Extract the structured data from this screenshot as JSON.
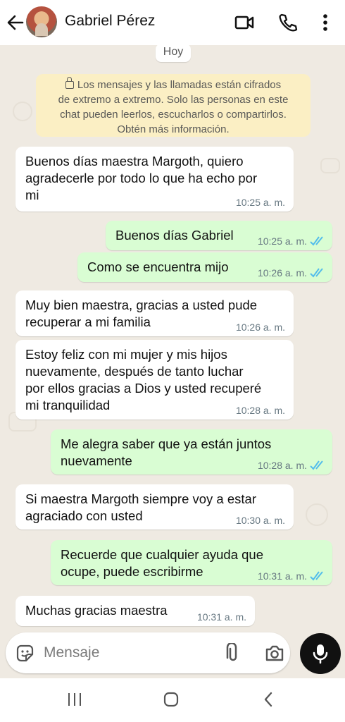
{
  "header": {
    "contact_name": "Gabriel Pérez",
    "icons": [
      "back-arrow-icon",
      "avatar",
      "video-call-icon",
      "phone-icon",
      "more-options-icon"
    ]
  },
  "chat": {
    "date_chip": "Hoy",
    "encryption_notice": "Los mensajes y las llamadas están cifrados\nde extremo a extremo. Solo las personas en este\nchat pueden leerlos, escucharlos o compartirlos.\nObtén más información.",
    "messages": [
      {
        "direction": "incoming",
        "text": "Buenos días maestra Margoth, quiero\nagradecerle por todo lo que ha echo por\nmi",
        "time": "10:25 a. m."
      },
      {
        "direction": "outgoing",
        "text": "Buenos días Gabriel",
        "time": "10:25 a. m.",
        "status": "read"
      },
      {
        "direction": "outgoing",
        "text": "Como se encuentra mijo",
        "time": "10:26 a. m.",
        "status": "read"
      },
      {
        "direction": "incoming",
        "text": "Muy bien maestra, gracias a usted pude\nrecuperar a mi familia",
        "time": "10:26 a. m."
      },
      {
        "direction": "incoming",
        "text": "Estoy feliz con mi mujer y mis hijos\nnuevamente, después de tanto luchar\npor ellos gracias a Dios y usted recuperé\nmi tranquilidad",
        "time": "10:28 a. m."
      },
      {
        "direction": "outgoing",
        "text": "Me alegra saber que ya están juntos\nnuevamente",
        "time": "10:28 a. m.",
        "status": "read"
      },
      {
        "direction": "incoming",
        "text": "Si maestra Margoth siempre voy a estar\nagraciado con usted",
        "time": "10:30 a. m."
      },
      {
        "direction": "outgoing",
        "text": "Recuerde que cualquier ayuda que\nocupe, puede escribirme",
        "time": "10:31 a. m.",
        "status": "read"
      },
      {
        "direction": "incoming",
        "text": "Muchas gracias maestra",
        "time": "10:31 a. m."
      }
    ]
  },
  "composer": {
    "placeholder": "Mensaje",
    "icons": [
      "sticker-icon",
      "attachment-icon",
      "camera-icon",
      "microphone-icon"
    ]
  },
  "system_nav": {
    "icons": [
      "recent-apps-icon",
      "home-icon",
      "back-icon"
    ]
  },
  "colors": {
    "chat_background": "#efeae2",
    "outgoing_bubble": "#d9fdd3",
    "incoming_bubble": "#ffffff",
    "notice_background": "#fbefc4",
    "read_checks": "#53bdeb"
  }
}
